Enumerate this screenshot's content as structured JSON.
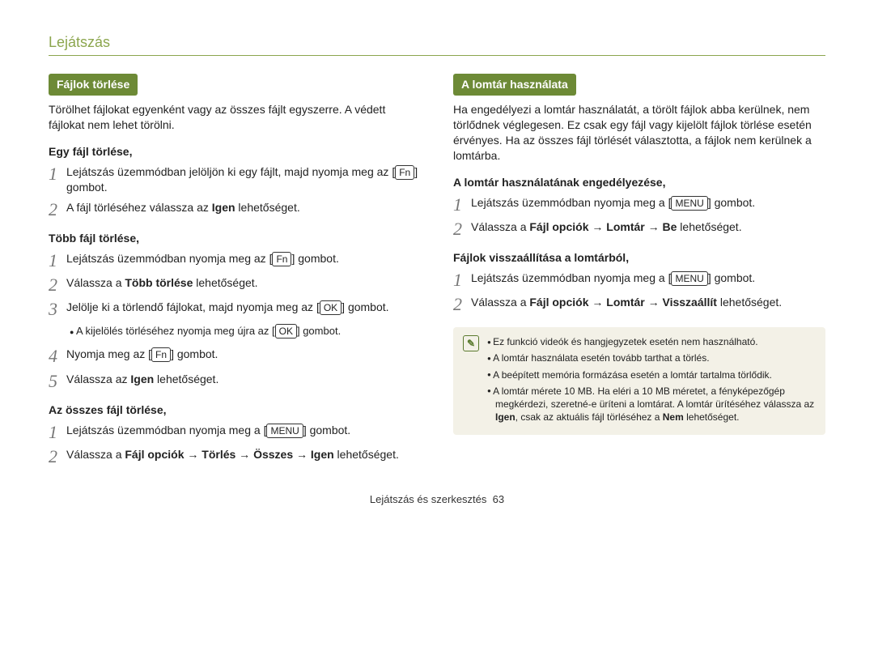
{
  "page_title": "Lejátszás",
  "left": {
    "heading": "Fájlok törlése",
    "intro": "Törölhet fájlokat egyenként vagy az összes fájlt egyszerre. A védett fájlokat nem lehet törölni.",
    "sub1": "Egy fájl törlése,",
    "s1a": "Lejátszás üzemmódban jelöljön ki egy fájlt, majd nyomja meg az ",
    "s1a_btn": "Fn",
    "s1a_after": " gombot.",
    "s1b_before": "A fájl törléséhez válassza az ",
    "s1b_bold": "Igen",
    "s1b_after": " lehetőséget.",
    "sub2": "Több fájl törlése,",
    "s2a": "Lejátszás üzemmódban nyomja meg az ",
    "s2a_btn": "Fn",
    "s2a_after": " gombot.",
    "s2b_before": "Válassza a ",
    "s2b_bold": "Több törlése",
    "s2b_after": " lehetőséget.",
    "s2c_before": "Jelölje ki a törlendő fájlokat, majd nyomja meg az ",
    "s2c_btn": "OK",
    "s2c_after": " gombot.",
    "s2c_bullet_before": "A kijelölés törléséhez nyomja meg újra az ",
    "s2c_bullet_btn": "OK",
    "s2c_bullet_after": " gombot.",
    "s2d_before": "Nyomja meg az ",
    "s2d_btn": "Fn",
    "s2d_after": " gombot.",
    "s2e_before": "Válassza az ",
    "s2e_bold": "Igen",
    "s2e_after": " lehetőséget.",
    "sub3": "Az összes fájl törlése,",
    "s3a_before": "Lejátszás üzemmódban nyomja meg a ",
    "s3a_btn": "MENU",
    "s3a_after": " gombot.",
    "s3b_before": "Válassza a ",
    "s3b_bold": "Fájl opciók → Törlés → Összes → Igen",
    "s3b_after": " lehetőséget."
  },
  "right": {
    "heading": "A lomtár használata",
    "intro": "Ha engedélyezi a lomtár használatát, a törölt fájlok abba kerülnek, nem törlődnek véglegesen. Ez csak egy fájl vagy kijelölt fájlok törlése esetén érvényes. Ha az összes fájl törlését választotta, a fájlok nem kerülnek a lomtárba.",
    "sub1": "A lomtár használatának engedélyezése,",
    "r1a_before": "Lejátszás üzemmódban nyomja meg a ",
    "r1a_btn": "MENU",
    "r1a_after": " gombot.",
    "r1b_before": "Válassza a ",
    "r1b_bold": "Fájl opciók → Lomtár → Be",
    "r1b_after": " lehetőséget.",
    "sub2": "Fájlok visszaállítása a lomtárból,",
    "r2a_before": "Lejátszás üzemmódban nyomja meg a ",
    "r2a_btn": "MENU",
    "r2a_after": " gombot.",
    "r2b_before": "Válassza a ",
    "r2b_bold": "Fájl opciók → Lomtár → Visszaállít",
    "r2b_after": " lehetőséget.",
    "notes": {
      "n1": "Ez funkció videók és hangjegyzetek esetén nem használható.",
      "n2": "A lomtár használata esetén tovább tarthat a törlés.",
      "n3": "A beépített memória formázása esetén a lomtár tartalma törlődik.",
      "n4_a": "A lomtár mérete 10 MB. Ha eléri a 10 MB méretet, a fényképezőgép megkérdezi, szeretné-e üríteni a lomtárat. A lomtár ürítéséhez válassza az ",
      "n4_bold1": "Igen",
      "n4_b": ", csak az aktuális fájl törléséhez a ",
      "n4_bold2": "Nem",
      "n4_c": " lehetőséget."
    }
  },
  "footer_label": "Lejátszás és szerkesztés",
  "footer_page": "63"
}
